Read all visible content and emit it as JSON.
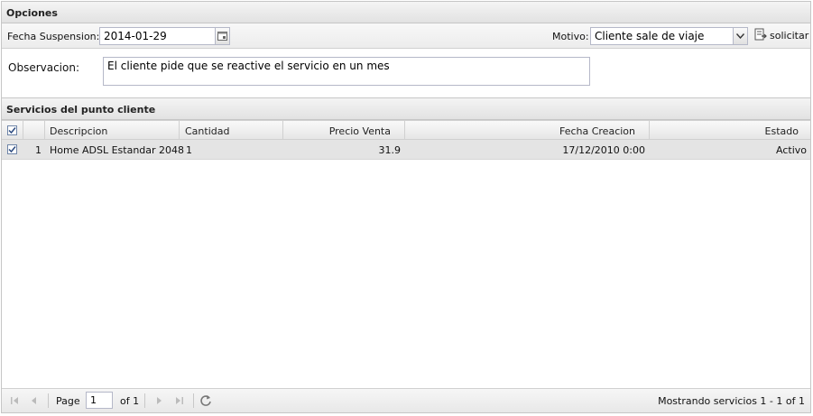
{
  "options": {
    "title": "Opciones",
    "fecha_label": "Fecha Suspension:",
    "fecha_value": "2014-01-29",
    "motivo_label": "Motivo:",
    "motivo_value": "Cliente sale de viaje",
    "solicitar_label": "solicitar",
    "observacion_label": "Observacion:",
    "observacion_value": "El cliente pide que se reactive el servicio en un mes"
  },
  "grid": {
    "title": "Servicios del punto cliente",
    "columns": {
      "descripcion": "Descripcion",
      "cantidad": "Cantidad",
      "precio": "Precio Venta",
      "fecha": "Fecha Creacion",
      "estado": "Estado"
    },
    "rows": [
      {
        "num": "1",
        "descripcion": "Home ADSL Estandar 2048",
        "cantidad": "1",
        "precio": "31.9",
        "fecha": "17/12/2010 0:00",
        "estado": "Activo",
        "checked": true
      }
    ]
  },
  "pager": {
    "page_label": "Page",
    "page_value": "1",
    "of_label": "of 1",
    "summary": "Mostrando servicios 1 - 1 of 1"
  },
  "icons": [
    "calendar-icon",
    "dropdown-arrow-icon",
    "request-icon",
    "checkbox-checked-icon",
    "first-page-icon",
    "prev-page-icon",
    "next-page-icon",
    "last-page-icon",
    "refresh-icon"
  ]
}
